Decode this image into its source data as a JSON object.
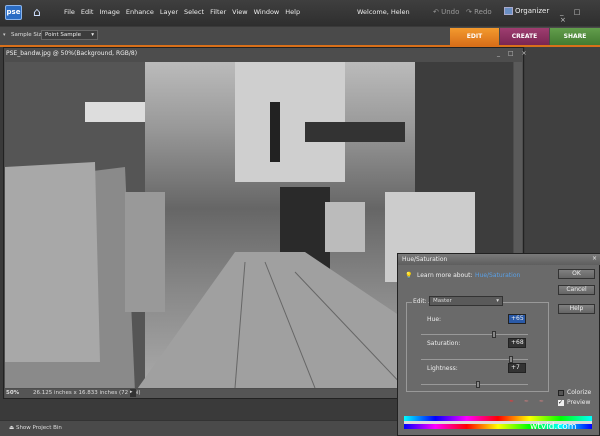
{
  "app": {
    "logo": "pse",
    "welcome": "Welcome, Helen",
    "undo": "Undo",
    "redo": "Redo",
    "organizer": "Organizer",
    "window_controls": "_ □ ×"
  },
  "menu": [
    "File",
    "Edit",
    "Image",
    "Enhance",
    "Layer",
    "Select",
    "Filter",
    "View",
    "Window",
    "Help"
  ],
  "options": {
    "sample_size_label": "Sample Size:",
    "sample_size_value": "Point Sample"
  },
  "tabs": [
    {
      "label": "EDIT",
      "color": "#e8821e"
    },
    {
      "label": "CREATE",
      "color": "#8a2f5e"
    },
    {
      "label": "SHARE",
      "color": "#4f8a3c"
    }
  ],
  "document": {
    "title": "PSE_bandw.jpg @ 50%(Background, RGB/8)",
    "controls": "_ □ ×",
    "zoom": "50%",
    "dimensions": "26.125 inches x 16.833 inches (72 ppi)"
  },
  "bottom": {
    "project_bin": "Show Project Bin"
  },
  "dialog": {
    "title": "Hue/Saturation",
    "close": "×",
    "learn_label": "Learn more about:",
    "learn_link": "Hue/Saturation",
    "ok": "OK",
    "cancel": "Cancel",
    "help": "Help",
    "edit_label": "Edit:",
    "edit_value": "Master",
    "hue_label": "Hue:",
    "hue_value": "+65",
    "hue": 65,
    "sat_label": "Saturation:",
    "sat_value": "+68",
    "sat": 68,
    "light_label": "Lightness:",
    "light_value": "+7",
    "light": 7,
    "colorize": "Colorize",
    "colorize_checked": false,
    "preview": "Preview",
    "preview_checked": true
  },
  "watermark": "wtvid.com"
}
